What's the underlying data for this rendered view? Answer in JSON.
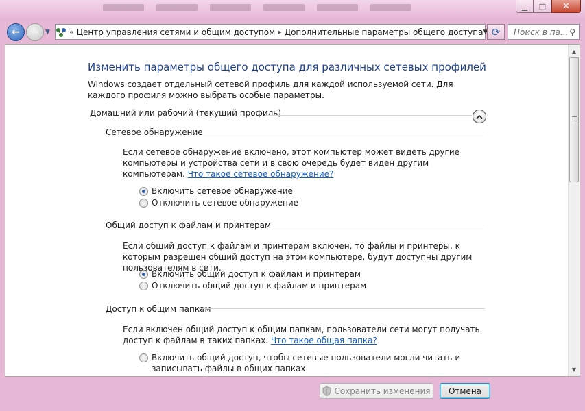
{
  "window": {
    "controls": {
      "minimize": "▁",
      "maximize": "□",
      "close": "✕"
    }
  },
  "nav": {
    "back_icon": "←",
    "forward_icon": "→",
    "breadcrumb": [
      "Центр управления сетями и общим доступом",
      "Дополнительные параметры общего доступа"
    ],
    "breadcrumb_separator": "«",
    "search_placeholder": "Поиск в па...",
    "refresh_icon": "⟳"
  },
  "page": {
    "title": "Изменить параметры общего доступа для различных сетевых профилей",
    "intro": "Windows создает отдельный сетевой профиль для каждой используемой сети. Для каждого профиля можно выбрать особые параметры.",
    "profile_header": "Домашний или рабочий (текущий профиль)",
    "sections": [
      {
        "title": "Сетевое обнаружение",
        "text": "Если сетевое обнаружение включено, этот компьютер может видеть другие компьютеры и устройства сети и в свою очередь будет виден другим компьютерам.",
        "link": "Что такое сетевое обнаружение?",
        "options": [
          {
            "label": "Включить сетевое обнаружение",
            "selected": true
          },
          {
            "label": "Отключить сетевое обнаружение",
            "selected": false
          }
        ]
      },
      {
        "title": "Общий доступ к файлам и принтерам",
        "text": "Если общий доступ к файлам и принтерам включен, то файлы и принтеры, к которым разрешен общий доступ на этом компьютере, будут доступны другим пользователям в сети.",
        "options": [
          {
            "label": "Включить общий доступ к файлам и принтерам",
            "selected": true
          },
          {
            "label": "Отключить общий доступ к файлам и принтерам",
            "selected": false
          }
        ]
      },
      {
        "title": "Доступ к общим папкам",
        "text": "Если включен общий доступ к общим папкам, пользователи сети могут получать доступ к файлам в таких папках.",
        "link": "Что такое общая папка?",
        "options": [
          {
            "label": "Включить общий доступ, чтобы сетевые пользователи могли читать и записывать файлы в общих папках",
            "selected": false
          }
        ]
      }
    ]
  },
  "buttons": {
    "save": "Сохранить изменения",
    "cancel": "Отмена"
  },
  "colors": {
    "title_blue": "#1e3f8a",
    "link_blue": "#1460c8",
    "window_frame": "#e7b8d6"
  }
}
